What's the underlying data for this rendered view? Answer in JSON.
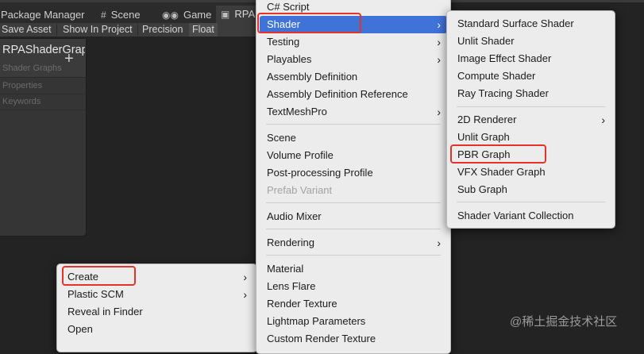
{
  "editor": {
    "tabs": {
      "package_manager": "Package Manager",
      "scene": "Scene",
      "game": "Game",
      "rpa_tab": "RPA"
    },
    "toolbar": {
      "save_asset": "Save Asset",
      "show_in_project": "Show In Project",
      "precision": "Precision",
      "float": "Float"
    },
    "blackboard": {
      "title": "RPAShaderGraph",
      "subtitle": "Shader Graphs",
      "properties": "Properties",
      "keywords": "Keywords",
      "add_icon": "+"
    }
  },
  "context_menu": {
    "items": [
      "Create",
      "Plastic SCM",
      "Reveal in Finder",
      "Open"
    ],
    "highlighted_boxed": "Create"
  },
  "create_menu": {
    "items": [
      "C# Script",
      "Shader",
      "Testing",
      "Playables",
      "Assembly Definition",
      "Assembly Definition Reference",
      "TextMeshPro",
      "Scene",
      "Volume Profile",
      "Post-processing Profile",
      "Prefab Variant",
      "Audio Mixer",
      "Rendering",
      "Material",
      "Lens Flare",
      "Render Texture",
      "Lightmap Parameters",
      "Custom Render Texture"
    ]
  },
  "shader_menu": {
    "items": [
      "Standard Surface Shader",
      "Unlit Shader",
      "Image Effect Shader",
      "Compute Shader",
      "Ray Tracing Shader",
      "2D Renderer",
      "Unlit Graph",
      "PBR Graph",
      "VFX Shader Graph",
      "Sub Graph",
      "Shader Variant Collection"
    ]
  },
  "icons": {
    "submenu_arrow": "›",
    "scene": "#",
    "game": "🎮"
  },
  "colors": {
    "highlight": "#3f73d8",
    "annotation_box": "#e5332a",
    "menu_bg": "#ececec"
  },
  "watermark": "@稀土掘金技术社区"
}
